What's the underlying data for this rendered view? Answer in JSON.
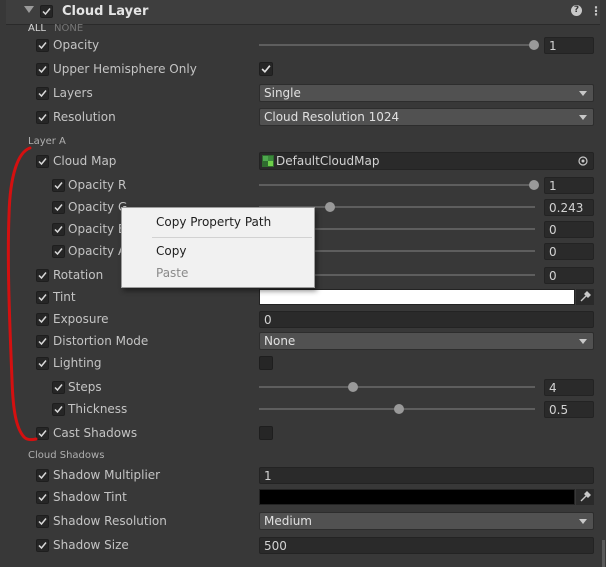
{
  "header": {
    "title": "Cloud Layer",
    "help_label": "?",
    "menu_label": "⋮"
  },
  "filter": {
    "all": "ALL",
    "none": "NONE"
  },
  "rows": {
    "opacity": {
      "label": "Opacity",
      "value": "1",
      "slider": 1.0
    },
    "upper_hemisphere": {
      "label": "Upper Hemisphere Only",
      "checked": true
    },
    "layers": {
      "label": "Layers",
      "value": "Single"
    },
    "resolution": {
      "label": "Resolution",
      "value": "Cloud Resolution 1024"
    }
  },
  "layer_a": {
    "section": "Layer A",
    "cloud_map": {
      "label": "Cloud Map",
      "value": "DefaultCloudMap"
    },
    "opacity_r": {
      "label": "Opacity R",
      "value": "1",
      "slider": 1.0
    },
    "opacity_g": {
      "label": "Opacity G",
      "value": "0.243",
      "slider": 0.243
    },
    "opacity_b": {
      "label": "Opacity B",
      "value": "0"
    },
    "opacity_a": {
      "label": "Opacity A",
      "value": "0"
    },
    "rotation": {
      "label": "Rotation",
      "value": "0"
    },
    "tint": {
      "label": "Tint",
      "color": "#ffffff"
    },
    "exposure": {
      "label": "Exposure",
      "value": "0"
    },
    "distortion": {
      "label": "Distortion Mode",
      "value": "None"
    },
    "lighting": {
      "label": "Lighting",
      "checked": false
    },
    "steps": {
      "label": "Steps",
      "value": "4",
      "slider": 0.33
    },
    "thickness": {
      "label": "Thickness",
      "value": "0.5",
      "slider": 0.5
    },
    "cast_shadows": {
      "label": "Cast Shadows",
      "checked": false
    }
  },
  "cloud_shadows": {
    "section": "Cloud Shadows",
    "multiplier": {
      "label": "Shadow Multiplier",
      "value": "1"
    },
    "tint": {
      "label": "Shadow Tint",
      "color": "#000000"
    },
    "resolution": {
      "label": "Shadow Resolution",
      "value": "Medium"
    },
    "size": {
      "label": "Shadow Size",
      "value": "500"
    }
  },
  "context_menu": {
    "copy_path": "Copy Property Path",
    "copy": "Copy",
    "paste": "Paste"
  },
  "colors": {
    "annotation": "#d41010",
    "background": "#383838"
  }
}
